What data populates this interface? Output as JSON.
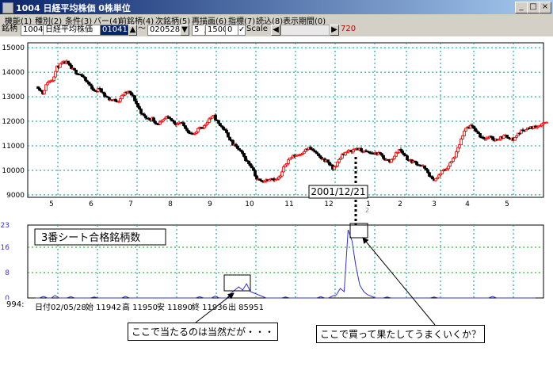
{
  "window": {
    "title": "1004 日経平均株価 0株単位",
    "min": "_",
    "max": "□",
    "close": "×"
  },
  "menu": [
    "機能(1)",
    "種別(2)",
    "条件(3)",
    "バー(4)",
    "前銘柄(4)",
    "次銘柄(5)",
    "再描画(6)",
    "指標(7)",
    "読込(8)",
    "表示期間(0)"
  ],
  "toolbar": {
    "label": "銘柄",
    "code": "1004",
    "name": "日経平均株価",
    "date_value": "010413",
    "dash": "〜",
    "date_to": "020528",
    "field_5": "5",
    "field_1500": "1500",
    "field_0": "0",
    "scale_check": "✓",
    "scale_label": "Scale",
    "right_value": "720"
  },
  "colors": {
    "accent": "#0a246a",
    "up": "#ff0000",
    "down": "#000000",
    "grid": "#009999",
    "count_line": "#3333cc"
  },
  "chart_data": [
    {
      "type": "candlestick",
      "yticks": [
        9000,
        10000,
        11000,
        12000,
        13000,
        14000,
        15000
      ],
      "ylim": [
        8900,
        15200
      ],
      "xticks": [
        "5",
        "6",
        "7",
        "8",
        "9",
        "10",
        "11",
        "12",
        "1",
        "2",
        "3",
        "4",
        "5"
      ],
      "grid": true,
      "close_path": [
        [
          0,
          13400
        ],
        [
          3,
          13150
        ],
        [
          6,
          13600
        ],
        [
          9,
          13700
        ],
        [
          12,
          14200
        ],
        [
          15,
          14350
        ],
        [
          18,
          14400
        ],
        [
          21,
          14150
        ],
        [
          24,
          14000
        ],
        [
          27,
          13900
        ],
        [
          30,
          13650
        ],
        [
          33,
          13450
        ],
        [
          36,
          13200
        ],
        [
          39,
          13350
        ],
        [
          42,
          13050
        ],
        [
          45,
          12900
        ],
        [
          48,
          12850
        ],
        [
          51,
          12850
        ],
        [
          54,
          13100
        ],
        [
          57,
          13200
        ],
        [
          60,
          13000
        ],
        [
          63,
          12600
        ],
        [
          66,
          12250
        ],
        [
          69,
          12100
        ],
        [
          72,
          12100
        ],
        [
          75,
          11900
        ],
        [
          78,
          11950
        ],
        [
          81,
          12150
        ],
        [
          84,
          12050
        ],
        [
          87,
          11900
        ],
        [
          90,
          11950
        ],
        [
          93,
          11750
        ],
        [
          96,
          11500
        ],
        [
          99,
          11450
        ],
        [
          102,
          11750
        ],
        [
          105,
          11800
        ],
        [
          108,
          12100
        ],
        [
          111,
          12200
        ],
        [
          114,
          11900
        ],
        [
          117,
          11700
        ],
        [
          120,
          11400
        ],
        [
          123,
          11050
        ],
        [
          126,
          10900
        ],
        [
          129,
          10650
        ],
        [
          132,
          10350
        ],
        [
          135,
          10150
        ],
        [
          138,
          9650
        ],
        [
          141,
          9550
        ],
        [
          144,
          9600
        ],
        [
          147,
          9700
        ],
        [
          150,
          9600
        ],
        [
          153,
          9750
        ],
        [
          156,
          10250
        ],
        [
          159,
          10500
        ],
        [
          162,
          10600
        ],
        [
          165,
          10650
        ],
        [
          168,
          10800
        ],
        [
          171,
          10900
        ],
        [
          174,
          10800
        ],
        [
          177,
          10550
        ],
        [
          180,
          10450
        ],
        [
          183,
          10350
        ],
        [
          186,
          10050
        ],
        [
          189,
          10300
        ],
        [
          192,
          10650
        ],
        [
          195,
          10750
        ],
        [
          198,
          10800
        ],
        [
          201,
          10900
        ],
        [
          204,
          10800
        ],
        [
          207,
          10750
        ],
        [
          210,
          10700
        ],
        [
          213,
          10700
        ],
        [
          216,
          10650
        ],
        [
          219,
          10450
        ],
        [
          222,
          10350
        ],
        [
          225,
          10600
        ],
        [
          228,
          10850
        ],
        [
          231,
          10650
        ],
        [
          234,
          10400
        ],
        [
          237,
          10350
        ],
        [
          240,
          10250
        ],
        [
          243,
          10150
        ],
        [
          246,
          9900
        ],
        [
          249,
          9600
        ],
        [
          252,
          9700
        ],
        [
          255,
          9950
        ],
        [
          258,
          10100
        ],
        [
          261,
          10350
        ],
        [
          264,
          10700
        ],
        [
          267,
          11250
        ],
        [
          270,
          11700
        ],
        [
          273,
          11800
        ],
        [
          276,
          11650
        ],
        [
          279,
          11400
        ],
        [
          282,
          11300
        ],
        [
          285,
          11350
        ],
        [
          288,
          11250
        ],
        [
          291,
          11300
        ],
        [
          294,
          11400
        ],
        [
          297,
          11350
        ],
        [
          300,
          11250
        ],
        [
          303,
          11500
        ],
        [
          306,
          11650
        ],
        [
          309,
          11700
        ],
        [
          312,
          11750
        ],
        [
          315,
          11800
        ],
        [
          318,
          11900
        ],
        [
          321,
          12000
        ]
      ],
      "annotation": "2001/12/21"
    },
    {
      "type": "line",
      "title": "3番シート合格銘柄数",
      "yticks": [
        0,
        8,
        16,
        23
      ],
      "ylim": [
        0,
        23
      ],
      "series": [
        {
          "values": [
            0,
            0,
            0.5,
            0,
            0,
            0.8,
            0,
            0,
            0,
            0.4,
            0,
            0,
            0,
            0,
            0,
            0.3,
            0,
            0,
            0,
            0,
            0,
            0,
            0,
            0.5,
            0,
            0,
            0,
            0,
            0,
            0,
            0,
            0,
            0,
            0,
            0,
            0,
            0,
            0,
            0,
            0,
            0,
            0,
            0.4,
            0,
            0,
            0,
            0.6,
            0,
            0,
            0,
            1.5,
            2.5,
            3.5,
            2.5,
            4.5,
            2,
            1.5,
            1,
            0.5,
            0,
            0,
            0,
            0,
            0,
            0.3,
            0,
            0,
            0,
            0,
            0,
            0,
            0,
            0,
            0.4,
            0,
            0,
            0.6,
            1,
            3,
            2,
            21.5,
            18,
            10,
            4,
            2,
            1,
            0.5,
            0,
            0,
            0,
            0.3,
            0,
            0,
            0,
            0,
            0,
            0,
            0,
            0,
            0,
            0,
            0,
            0.3,
            0,
            0,
            0,
            0,
            0,
            0,
            0,
            0,
            0,
            0,
            0,
            0,
            0,
            0,
            0.5,
            0,
            0,
            0,
            0,
            0,
            0,
            0,
            0,
            0,
            0,
            0
          ]
        }
      ]
    }
  ],
  "info": {
    "row": "994:",
    "date": "日付02/05/28",
    "open": "始 11942",
    "high": "高 11950",
    "low": "安 11890",
    "close": "終 11936",
    "volume": "出 85951"
  },
  "callouts": {
    "left": "ここで当たるのは当然だが・・・",
    "right": "ここで買って果たしてうまくいくか？"
  },
  "marker_label": "2"
}
